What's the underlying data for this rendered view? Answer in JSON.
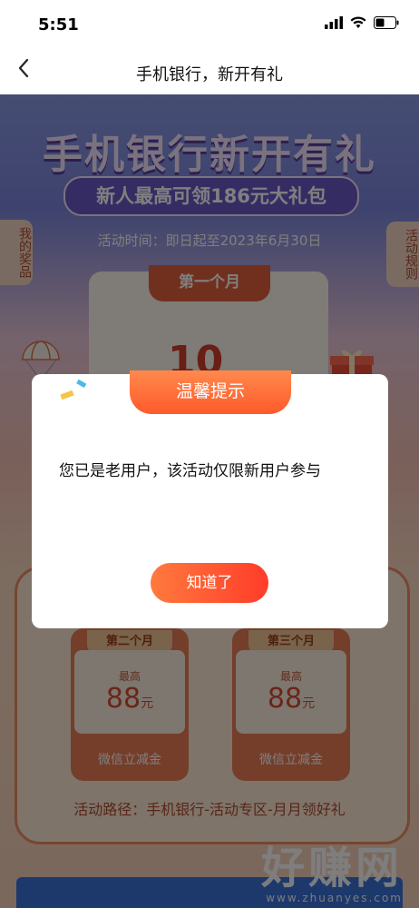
{
  "status_bar": {
    "time": "5:51"
  },
  "nav": {
    "title": "手机银行，新开有礼"
  },
  "banner": {
    "title": "手机银行新开有礼",
    "subtitle": "新人最高可领186元大礼包",
    "activity_time": "活动时间：即日起至2023年6月30日"
  },
  "side_tabs": {
    "my_prizes": "我的奖品",
    "rules": "活动规则"
  },
  "month1": {
    "label": "第一个月",
    "amount_partial": "10"
  },
  "coupons": [
    {
      "label": "第二个月",
      "prefix": "最高",
      "amount": "88",
      "unit": "元",
      "desc": "微信立减金"
    },
    {
      "label": "第三个月",
      "prefix": "最高",
      "amount": "88",
      "unit": "元",
      "desc": "微信立减金"
    }
  ],
  "route": "活动路径：手机银行-活动专区-月月领好礼",
  "watermark": {
    "main": "好赚网",
    "url": "www.zhuanyes.com"
  },
  "modal": {
    "title": "温馨提示",
    "message": "您已是老用户，该活动仅限新用户参与",
    "button": "知道了"
  },
  "colors": {
    "accent": "#ff5a2b",
    "banner": "#7b86dd"
  }
}
